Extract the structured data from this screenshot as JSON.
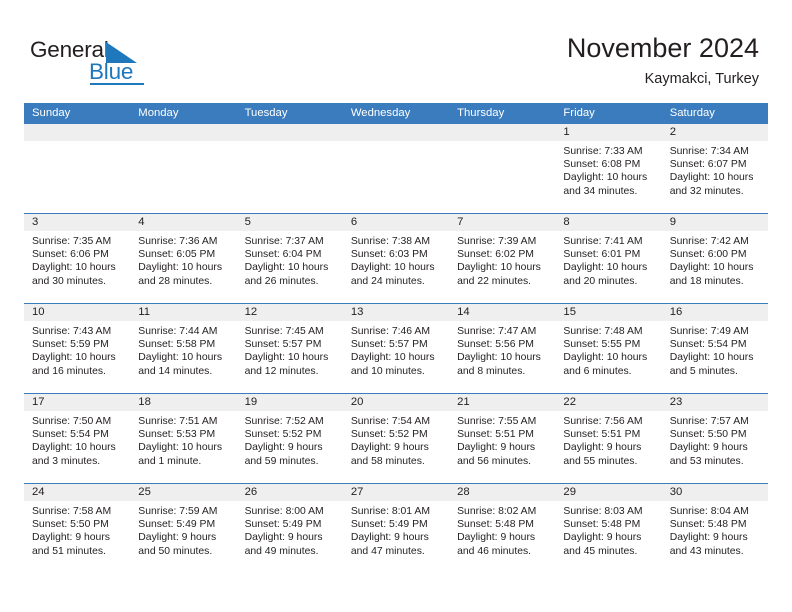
{
  "brand": {
    "name_part1": "General",
    "name_part2": "Blue",
    "accent_color": "#1f77bc",
    "logo_icon": "triangle-flag-icon"
  },
  "header": {
    "title": "November 2024",
    "subtitle": "Kaymakci, Turkey"
  },
  "theme": {
    "header_blue": "#3a7cbe",
    "daynum_band": "#efefef",
    "text": "#231f20"
  },
  "weekdays": [
    "Sunday",
    "Monday",
    "Tuesday",
    "Wednesday",
    "Thursday",
    "Friday",
    "Saturday"
  ],
  "weeks": [
    [
      {
        "day": "",
        "lines": []
      },
      {
        "day": "",
        "lines": []
      },
      {
        "day": "",
        "lines": []
      },
      {
        "day": "",
        "lines": []
      },
      {
        "day": "",
        "lines": []
      },
      {
        "day": "1",
        "lines": [
          "Sunrise: 7:33 AM",
          "Sunset: 6:08 PM",
          "Daylight: 10 hours",
          "and 34 minutes."
        ]
      },
      {
        "day": "2",
        "lines": [
          "Sunrise: 7:34 AM",
          "Sunset: 6:07 PM",
          "Daylight: 10 hours",
          "and 32 minutes."
        ]
      }
    ],
    [
      {
        "day": "3",
        "lines": [
          "Sunrise: 7:35 AM",
          "Sunset: 6:06 PM",
          "Daylight: 10 hours",
          "and 30 minutes."
        ]
      },
      {
        "day": "4",
        "lines": [
          "Sunrise: 7:36 AM",
          "Sunset: 6:05 PM",
          "Daylight: 10 hours",
          "and 28 minutes."
        ]
      },
      {
        "day": "5",
        "lines": [
          "Sunrise: 7:37 AM",
          "Sunset: 6:04 PM",
          "Daylight: 10 hours",
          "and 26 minutes."
        ]
      },
      {
        "day": "6",
        "lines": [
          "Sunrise: 7:38 AM",
          "Sunset: 6:03 PM",
          "Daylight: 10 hours",
          "and 24 minutes."
        ]
      },
      {
        "day": "7",
        "lines": [
          "Sunrise: 7:39 AM",
          "Sunset: 6:02 PM",
          "Daylight: 10 hours",
          "and 22 minutes."
        ]
      },
      {
        "day": "8",
        "lines": [
          "Sunrise: 7:41 AM",
          "Sunset: 6:01 PM",
          "Daylight: 10 hours",
          "and 20 minutes."
        ]
      },
      {
        "day": "9",
        "lines": [
          "Sunrise: 7:42 AM",
          "Sunset: 6:00 PM",
          "Daylight: 10 hours",
          "and 18 minutes."
        ]
      }
    ],
    [
      {
        "day": "10",
        "lines": [
          "Sunrise: 7:43 AM",
          "Sunset: 5:59 PM",
          "Daylight: 10 hours",
          "and 16 minutes."
        ]
      },
      {
        "day": "11",
        "lines": [
          "Sunrise: 7:44 AM",
          "Sunset: 5:58 PM",
          "Daylight: 10 hours",
          "and 14 minutes."
        ]
      },
      {
        "day": "12",
        "lines": [
          "Sunrise: 7:45 AM",
          "Sunset: 5:57 PM",
          "Daylight: 10 hours",
          "and 12 minutes."
        ]
      },
      {
        "day": "13",
        "lines": [
          "Sunrise: 7:46 AM",
          "Sunset: 5:57 PM",
          "Daylight: 10 hours",
          "and 10 minutes."
        ]
      },
      {
        "day": "14",
        "lines": [
          "Sunrise: 7:47 AM",
          "Sunset: 5:56 PM",
          "Daylight: 10 hours",
          "and 8 minutes."
        ]
      },
      {
        "day": "15",
        "lines": [
          "Sunrise: 7:48 AM",
          "Sunset: 5:55 PM",
          "Daylight: 10 hours",
          "and 6 minutes."
        ]
      },
      {
        "day": "16",
        "lines": [
          "Sunrise: 7:49 AM",
          "Sunset: 5:54 PM",
          "Daylight: 10 hours",
          "and 5 minutes."
        ]
      }
    ],
    [
      {
        "day": "17",
        "lines": [
          "Sunrise: 7:50 AM",
          "Sunset: 5:54 PM",
          "Daylight: 10 hours",
          "and 3 minutes."
        ]
      },
      {
        "day": "18",
        "lines": [
          "Sunrise: 7:51 AM",
          "Sunset: 5:53 PM",
          "Daylight: 10 hours",
          "and 1 minute."
        ]
      },
      {
        "day": "19",
        "lines": [
          "Sunrise: 7:52 AM",
          "Sunset: 5:52 PM",
          "Daylight: 9 hours",
          "and 59 minutes."
        ]
      },
      {
        "day": "20",
        "lines": [
          "Sunrise: 7:54 AM",
          "Sunset: 5:52 PM",
          "Daylight: 9 hours",
          "and 58 minutes."
        ]
      },
      {
        "day": "21",
        "lines": [
          "Sunrise: 7:55 AM",
          "Sunset: 5:51 PM",
          "Daylight: 9 hours",
          "and 56 minutes."
        ]
      },
      {
        "day": "22",
        "lines": [
          "Sunrise: 7:56 AM",
          "Sunset: 5:51 PM",
          "Daylight: 9 hours",
          "and 55 minutes."
        ]
      },
      {
        "day": "23",
        "lines": [
          "Sunrise: 7:57 AM",
          "Sunset: 5:50 PM",
          "Daylight: 9 hours",
          "and 53 minutes."
        ]
      }
    ],
    [
      {
        "day": "24",
        "lines": [
          "Sunrise: 7:58 AM",
          "Sunset: 5:50 PM",
          "Daylight: 9 hours",
          "and 51 minutes."
        ]
      },
      {
        "day": "25",
        "lines": [
          "Sunrise: 7:59 AM",
          "Sunset: 5:49 PM",
          "Daylight: 9 hours",
          "and 50 minutes."
        ]
      },
      {
        "day": "26",
        "lines": [
          "Sunrise: 8:00 AM",
          "Sunset: 5:49 PM",
          "Daylight: 9 hours",
          "and 49 minutes."
        ]
      },
      {
        "day": "27",
        "lines": [
          "Sunrise: 8:01 AM",
          "Sunset: 5:49 PM",
          "Daylight: 9 hours",
          "and 47 minutes."
        ]
      },
      {
        "day": "28",
        "lines": [
          "Sunrise: 8:02 AM",
          "Sunset: 5:48 PM",
          "Daylight: 9 hours",
          "and 46 minutes."
        ]
      },
      {
        "day": "29",
        "lines": [
          "Sunrise: 8:03 AM",
          "Sunset: 5:48 PM",
          "Daylight: 9 hours",
          "and 45 minutes."
        ]
      },
      {
        "day": "30",
        "lines": [
          "Sunrise: 8:04 AM",
          "Sunset: 5:48 PM",
          "Daylight: 9 hours",
          "and 43 minutes."
        ]
      }
    ]
  ]
}
